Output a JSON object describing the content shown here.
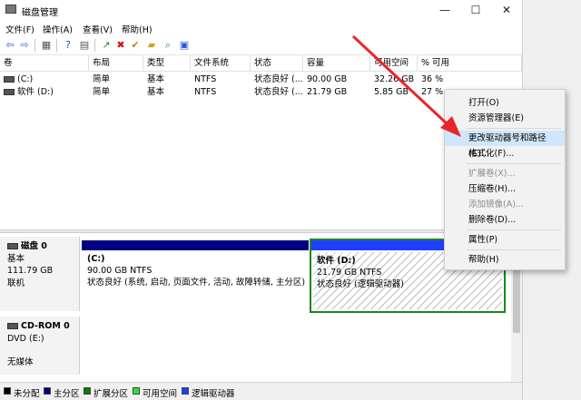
{
  "window": {
    "title": "磁盘管理",
    "controls": [
      "—",
      "☐",
      "✕"
    ]
  },
  "menu": [
    "文件(F)",
    "操作(A)",
    "查看(V)",
    "帮助(H)"
  ],
  "table": {
    "headers": [
      "卷",
      "布局",
      "类型",
      "文件系统",
      "状态",
      "容量",
      "可用空间",
      "% 可用"
    ],
    "rows": [
      [
        "(C:)",
        "简单",
        "基本",
        "NTFS",
        "状态良好 (...",
        "90.00 GB",
        "32.26 GB",
        "36 %"
      ],
      [
        "软件 (D:)",
        "简单",
        "基本",
        "NTFS",
        "状态良好 (...",
        "21.79 GB",
        "5.85 GB",
        "27 %"
      ]
    ]
  },
  "disks": [
    {
      "name": "磁盘 0",
      "type": "基本",
      "size": "111.79 GB",
      "status": "联机",
      "partitions": [
        {
          "name": "(C:)",
          "size": "90.00 GB NTFS",
          "status": "状态良好 (系统, 启动, 页面文件, 活动, 故障转储, 主分区)"
        },
        {
          "name": "软件  (D:)",
          "size": "21.79 GB NTFS",
          "status": "状态良好 (逻辑驱动器)"
        }
      ]
    },
    {
      "name": "CD-ROM 0",
      "type": "DVD (E:)",
      "size": "",
      "status": "无媒体"
    }
  ],
  "legend": [
    {
      "label": "未分配",
      "color": "#000000"
    },
    {
      "label": "主分区",
      "color": "#000080"
    },
    {
      "label": "扩展分区",
      "color": "#008000"
    },
    {
      "label": "可用空间",
      "color": "#33dd33"
    },
    {
      "label": "逻辑驱动器",
      "color": "#1f3fff"
    }
  ],
  "context_menu": [
    {
      "label": "打开(O)",
      "enabled": true
    },
    {
      "label": "资源管理器(E)",
      "enabled": true
    },
    {
      "label": "更改驱动器号和路径(C)...",
      "enabled": true,
      "highlighted": true
    },
    {
      "label": "格式化(F)...",
      "enabled": true
    },
    {
      "label": "扩展卷(X)...",
      "enabled": false
    },
    {
      "label": "压缩卷(H)...",
      "enabled": true
    },
    {
      "label": "添加镜像(A)...",
      "enabled": false
    },
    {
      "label": "删除卷(D)...",
      "enabled": true
    },
    {
      "label": "属性(P)",
      "enabled": true
    },
    {
      "label": "帮助(H)",
      "enabled": true
    }
  ],
  "colors": {
    "primary_partition": "#000080",
    "logical_drive": "#1f3fff",
    "selected_border": "#1a8a1a",
    "arrow": "#e8262a",
    "menu_highlight": "#d0e6fa"
  }
}
